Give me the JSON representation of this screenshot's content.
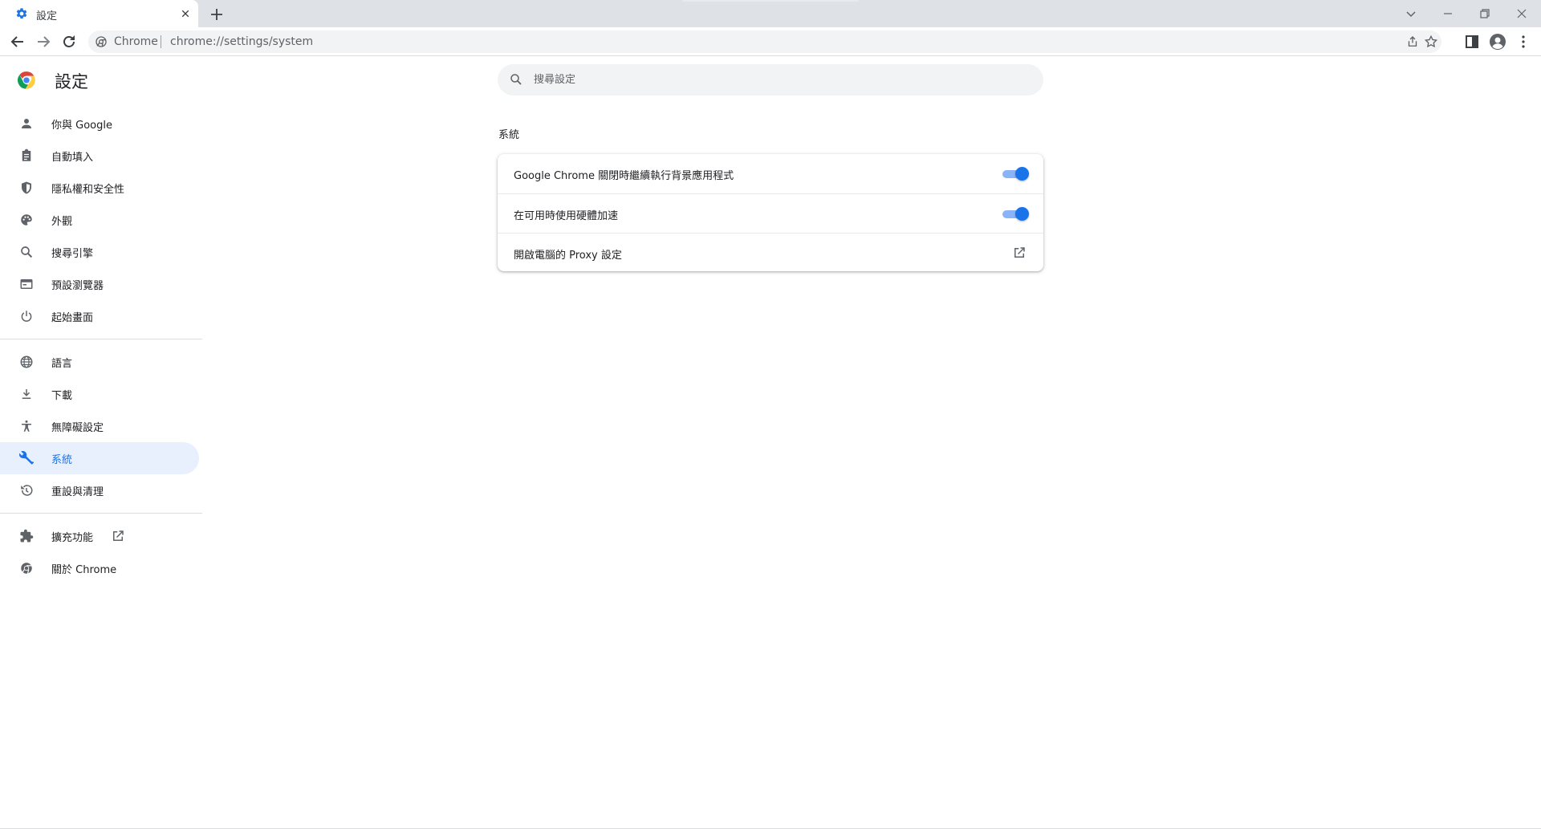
{
  "browser": {
    "tab": {
      "title": "設定",
      "favicon": "gear-icon"
    },
    "omnibox": {
      "site": "Chrome",
      "url": "chrome://settings/system"
    }
  },
  "settings": {
    "title": "設定",
    "search": {
      "placeholder": "搜尋設定"
    },
    "nav": {
      "items": [
        {
          "label": "你與 Google",
          "icon": "person-icon"
        },
        {
          "label": "自動填入",
          "icon": "clipboard-icon"
        },
        {
          "label": "隱私權和安全性",
          "icon": "shield-icon"
        },
        {
          "label": "外觀",
          "icon": "palette-icon"
        },
        {
          "label": "搜尋引擎",
          "icon": "search-icon"
        },
        {
          "label": "預設瀏覽器",
          "icon": "browser-icon"
        },
        {
          "label": "起始畫面",
          "icon": "power-icon"
        },
        {
          "label": "語言",
          "icon": "globe-icon"
        },
        {
          "label": "下載",
          "icon": "download-icon"
        },
        {
          "label": "無障礙設定",
          "icon": "accessibility-icon"
        },
        {
          "label": "系統",
          "icon": "wrench-icon",
          "active": true
        },
        {
          "label": "重設與清理",
          "icon": "restore-icon"
        },
        {
          "label": "擴充功能",
          "icon": "puzzle-icon"
        },
        {
          "label": "關於 Chrome",
          "icon": "chrome-icon"
        }
      ]
    },
    "system": {
      "heading": "系統",
      "rows": [
        {
          "label": "Google Chrome 關閉時繼續執行背景應用程式",
          "control": "toggle",
          "on": true
        },
        {
          "label": "在可用時使用硬體加速",
          "control": "toggle",
          "on": true
        },
        {
          "label": "開啟電腦的 Proxy 設定",
          "control": "external-link"
        }
      ]
    }
  },
  "colors": {
    "accent": "#1a73e8",
    "toggle_track": "#8ab4f8",
    "active_nav_bg": "#e8f0fe"
  }
}
